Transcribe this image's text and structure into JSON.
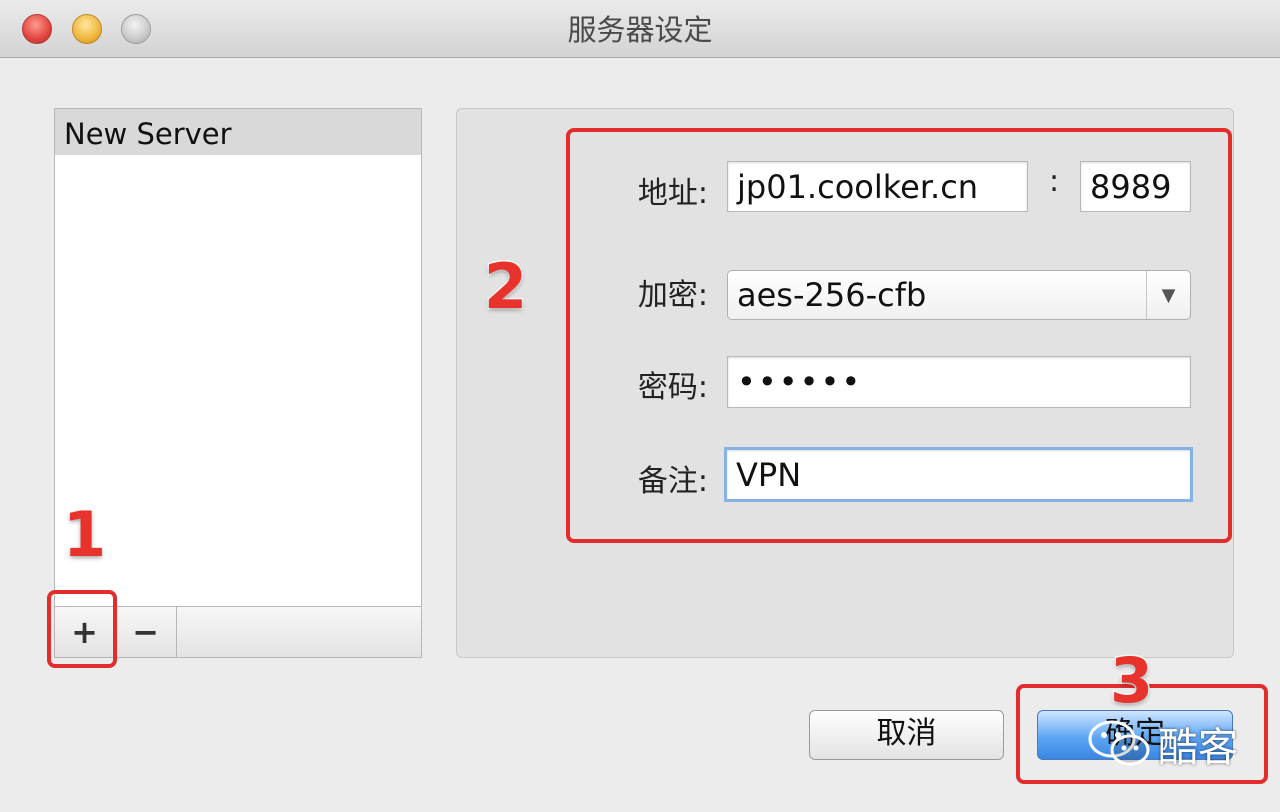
{
  "window": {
    "title": "服务器设定"
  },
  "server_list": {
    "items": [
      "New Server"
    ],
    "add_button": "+",
    "remove_button": "−"
  },
  "form": {
    "address_label": "地址:",
    "address_value": "jp01.coolker.cn",
    "port_separator": ":",
    "port_value": "8989",
    "encryption_label": "加密:",
    "encryption_value": "aes-256-cfb",
    "password_label": "密码:",
    "password_value": "••••••",
    "remark_label": "备注:",
    "remark_value": "VPN"
  },
  "buttons": {
    "cancel": "取消",
    "ok": "确定"
  },
  "annotations": {
    "step1": "1",
    "step2": "2",
    "step3": "3"
  },
  "watermark": {
    "text": "酷客"
  },
  "colors": {
    "highlight": "#e32d2d",
    "ok_button": "#5ea6f4",
    "focus_ring": "#86b2e6"
  }
}
